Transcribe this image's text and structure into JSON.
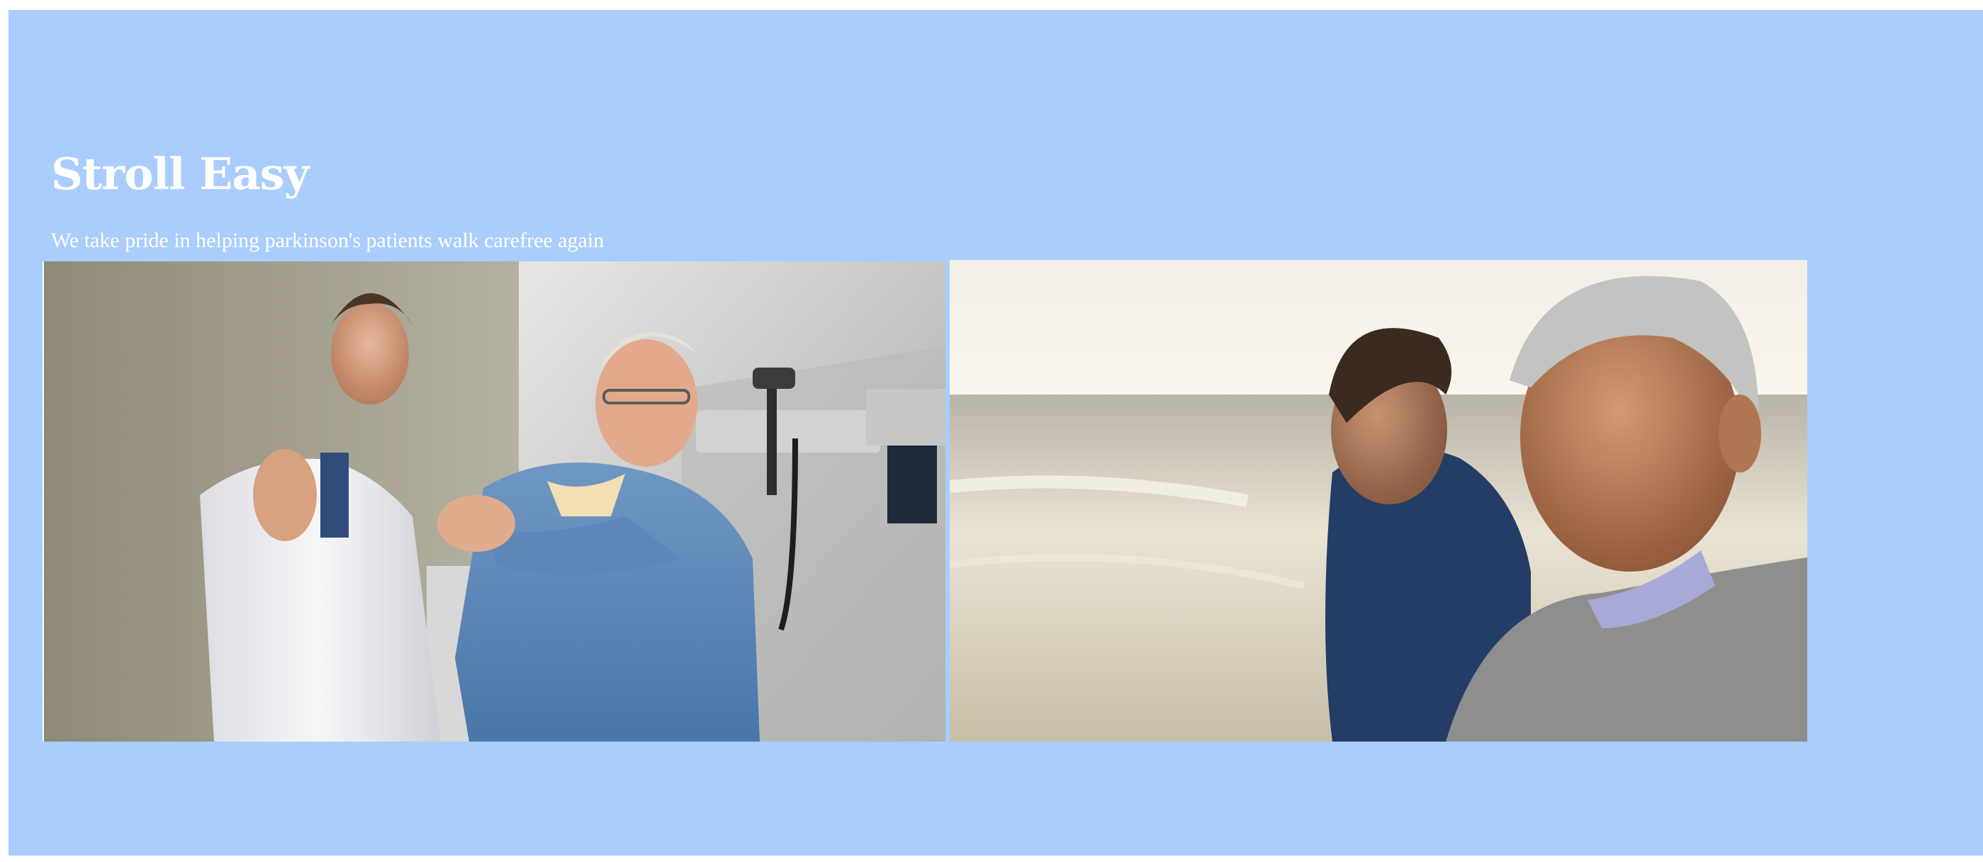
{
  "hero": {
    "title": "Stroll Easy",
    "subtitle": "We take pride in helping parkinson's patients walk carefree again",
    "background_color": "#a9cdfc",
    "text_color": "#ffffff"
  },
  "photos": [
    {
      "subject": "doctor-examining-patient-photo"
    },
    {
      "subject": "father-and-son-on-beach-photo"
    }
  ]
}
